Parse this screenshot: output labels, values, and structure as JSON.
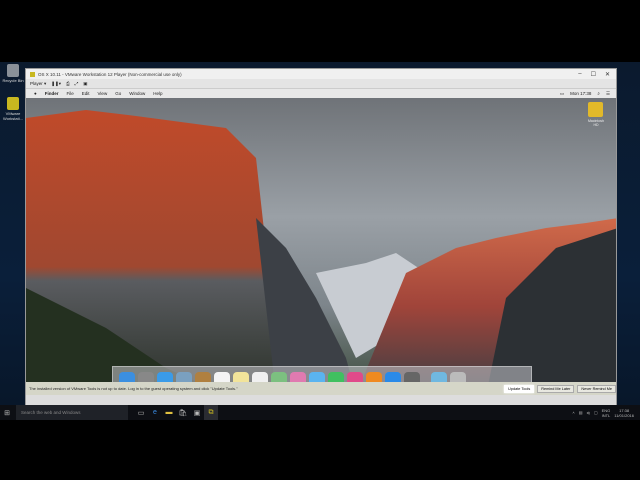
{
  "desktop": {
    "icons": [
      {
        "label": "Recycle Bin"
      },
      {
        "label": "VMware Workstati..."
      }
    ]
  },
  "window": {
    "title": "OS X 10.11 - VMware Workstation 12 Player (Non-commercial use only)",
    "player_menu": "Player ▾",
    "controls": [
      "–",
      "☐",
      "✕"
    ]
  },
  "mac": {
    "menu": [
      "Finder",
      "File",
      "Edit",
      "View",
      "Go",
      "Window",
      "Help"
    ],
    "clock": "Mon 17:38",
    "hdd_label": "Macintosh HD"
  },
  "dock": {
    "icons": [
      "finder",
      "launchpad",
      "safari",
      "mail-stamp",
      "contacts",
      "calendar",
      "notes",
      "reminders",
      "maps",
      "photos",
      "messages",
      "facetime",
      "itunes",
      "ibooks",
      "app-store",
      "system-preferences",
      "downloads",
      "trash"
    ],
    "colors": [
      "#3b8fe0",
      "#888",
      "#3a9be8",
      "#7aa0c0",
      "#b08040",
      "#f4f4f4",
      "#f2e49a",
      "#f0f0f0",
      "#7cc080",
      "#e07ab0",
      "#5ab4f0",
      "#40c060",
      "#e04a8a",
      "#f08a20",
      "#2a8ae8",
      "#666",
      "#70b8e0",
      "#bbb"
    ]
  },
  "notification": {
    "message": "The installed version of VMware Tools is not up to date. Log in to the guest operating system and click \"Update Tools.\"",
    "buttons": [
      "Update Tools",
      "Remind Me Later",
      "Never Remind Me"
    ]
  },
  "taskbar": {
    "search_placeholder": "Search the web and Windows",
    "lang": "ENG",
    "lang2": "INTL",
    "time": "17:38",
    "date": "11/01/2016"
  }
}
